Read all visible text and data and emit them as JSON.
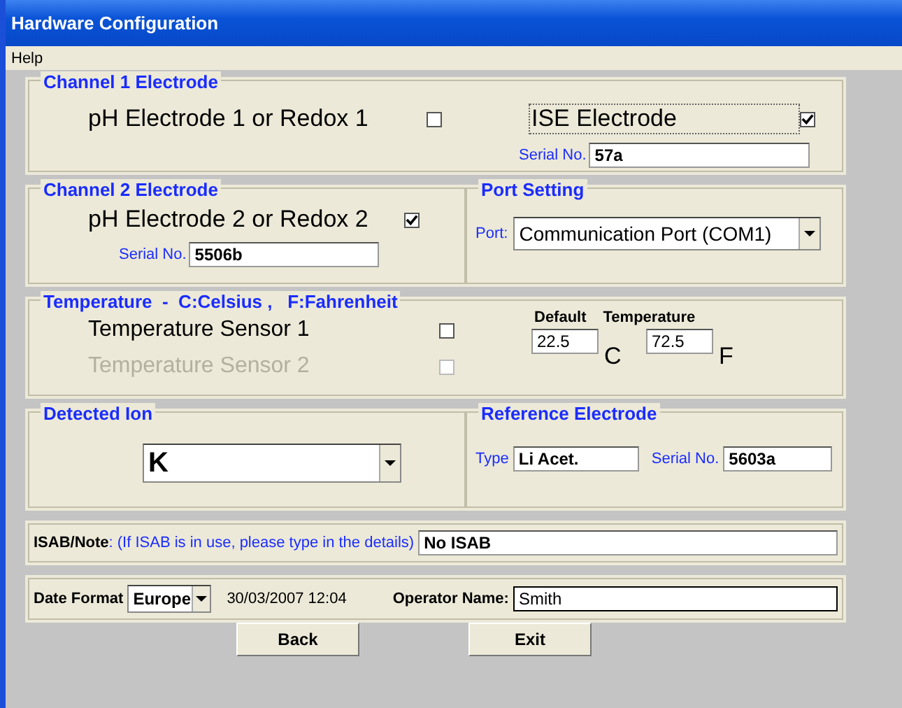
{
  "window": {
    "title": "Hardware Configuration"
  },
  "menu": [
    "Help"
  ],
  "channel_1": {
    "title": "Channel 1 Electrode",
    "ph_label": "pH Electrode 1 or Redox 1",
    "ph_checked": false,
    "ise_label": "ISE Electrode",
    "ise_checked": true,
    "serial_label": "Serial No.",
    "serial": "57a"
  },
  "channel_2": {
    "title": "Channel 2 Electrode",
    "ph_label": "pH Electrode 2 or Redox 2",
    "ph_checked": true,
    "serial_label": "Serial No.",
    "serial": "5506b"
  },
  "port_setting": {
    "title": "Port Setting",
    "label": "Port:",
    "value": "Communication Port (COM1)"
  },
  "temperature": {
    "title": "Temperature  -  C:Celsius ,   F:Fahrenheit",
    "sensors": [
      {
        "label": "Temperature Sensor 1",
        "checked": false,
        "disabled": false
      },
      {
        "label": "Temperature Sensor 2",
        "checked": false,
        "disabled": true
      }
    ],
    "default_label": "Default",
    "temperature_label": "Temperature",
    "celsius": "22.5",
    "celsius_unit": "C",
    "fahrenheit": "72.5",
    "fahrenheit_unit": "F"
  },
  "detected_ion": {
    "title": "Detected Ion",
    "value": "K"
  },
  "reference_electrode": {
    "title": "Reference Electrode",
    "type_label": "Type",
    "type": "Li Acet.",
    "serial_label": "Serial No.",
    "serial": "5603a"
  },
  "isab": {
    "label": "ISAB/Note",
    "hint": ": (If ISAB is in use, please type in the details)",
    "value": "No ISAB"
  },
  "date": {
    "label": "Date Format",
    "format": "Europe",
    "datetime": "30/03/2007 12:04",
    "operator_label": "Operator Name:",
    "operator": "Smith"
  },
  "buttons": [
    "Back",
    "Exit"
  ]
}
